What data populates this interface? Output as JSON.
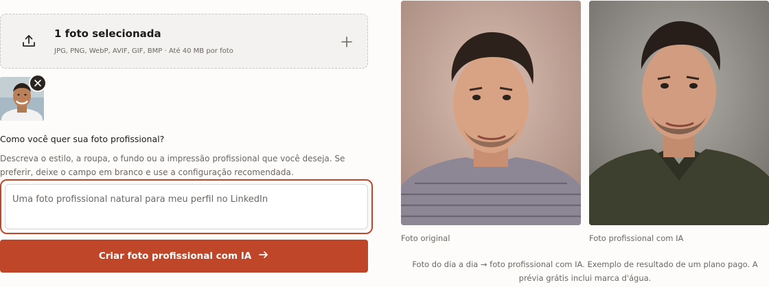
{
  "upload": {
    "title": "1 foto selecionada",
    "subtitle": "JPG, PNG, WebP, AVIF, GIF, BMP · Até 40 MB por foto"
  },
  "prompt": {
    "question": "Como você quer sua foto profissional?",
    "description": "Descreva o estilo, a roupa, o fundo ou a impressão profissional que você deseja. Se preferir, deixe o campo em branco e use a configuração recomendada.",
    "value": "Uma foto profissional natural para meu perfil no LinkedIn"
  },
  "cta": {
    "label": "Criar foto profissional com IA"
  },
  "example": {
    "original_caption": "Foto original",
    "result_caption": "Foto profissional com IA",
    "footnote": "Foto do dia a dia → foto profissional com IA. Exemplo de resultado de um plano pago. A prévia grátis inclui marca d'água."
  },
  "colors": {
    "accent": "#c0462a",
    "upload_bg": "#f3f2f0"
  },
  "icons": {
    "upload": "upload-icon",
    "add": "plus-icon",
    "remove": "close-icon",
    "arrow": "arrow-right-icon"
  }
}
